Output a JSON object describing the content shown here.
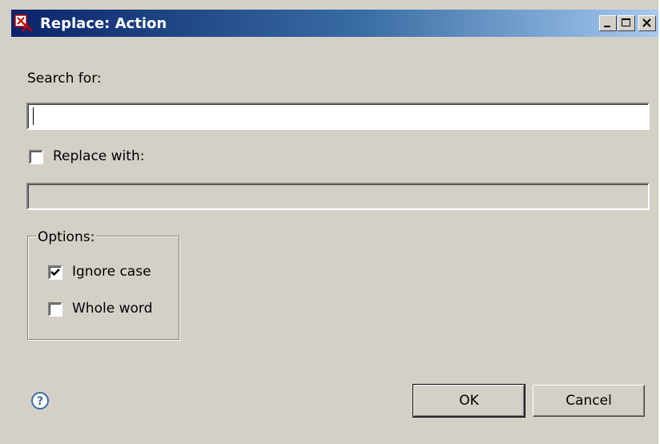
{
  "window": {
    "title": "Replace: Action",
    "icons": {
      "app": "app-icon",
      "minimize": "minimize-icon",
      "maximize": "maximize-icon",
      "close": "close-icon"
    }
  },
  "search": {
    "label": "Search for:",
    "value": ""
  },
  "replace": {
    "label": "Replace with:",
    "checked": false,
    "value": ""
  },
  "options": {
    "legend": "Options:",
    "ignore_case": {
      "label": "Ignore case",
      "checked": true
    },
    "whole_word": {
      "label": "Whole word",
      "checked": false
    }
  },
  "buttons": {
    "ok": "OK",
    "cancel": "Cancel"
  },
  "help": {
    "icon": "help-icon"
  },
  "colors": {
    "dialog_bg": "#d4d0c8",
    "title_start": "#0a246a",
    "title_end": "#a6caf0",
    "help_blue": "#3a6ea5"
  }
}
